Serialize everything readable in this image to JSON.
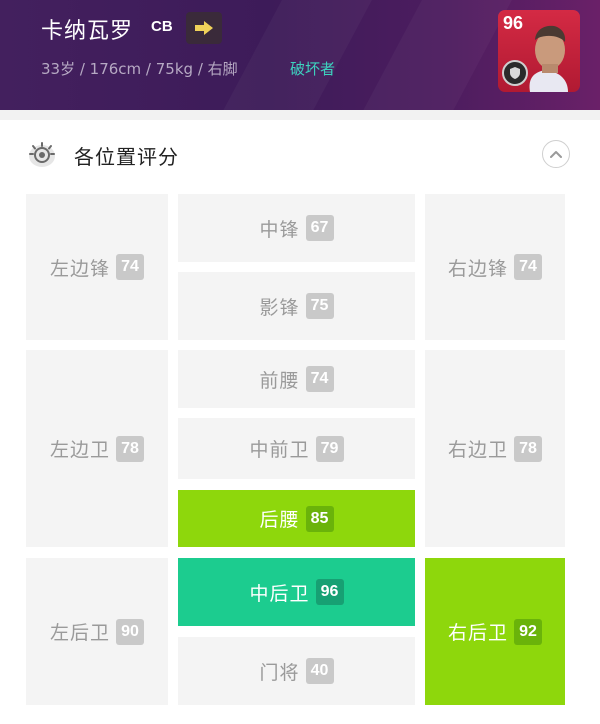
{
  "player": {
    "name": "卡纳瓦罗",
    "position": "CB",
    "stats": "33岁 / 176cm / 75kg / 右脚",
    "type": "破坏者",
    "rating": "96"
  },
  "section": {
    "title": "各位置评分"
  },
  "positions": {
    "lwf": {
      "label": "左边锋",
      "rating": "74"
    },
    "cf": {
      "label": "中锋",
      "rating": "67"
    },
    "ss": {
      "label": "影锋",
      "rating": "75"
    },
    "rwf": {
      "label": "右边锋",
      "rating": "74"
    },
    "lmf": {
      "label": "左边卫",
      "rating": "78"
    },
    "amf": {
      "label": "前腰",
      "rating": "74"
    },
    "cmf": {
      "label": "中前卫",
      "rating": "79"
    },
    "dmf": {
      "label": "后腰",
      "rating": "85"
    },
    "rmf": {
      "label": "右边卫",
      "rating": "78"
    },
    "lb": {
      "label": "左后卫",
      "rating": "90"
    },
    "cb": {
      "label": "中后卫",
      "rating": "96"
    },
    "gk": {
      "label": "门将",
      "rating": "40"
    },
    "rb": {
      "label": "右后卫",
      "rating": "92"
    }
  },
  "colors": {
    "header_bg": "#43205e",
    "player_type": "#3dd3bf",
    "card_red": "#c8243c",
    "highlight_lime": "#8ed70c",
    "highlight_teal": "#1ccc8f",
    "cell_gray": "#f4f4f4"
  },
  "icons": {
    "switch": "arrow-right-icon",
    "section": "eye-icon",
    "collapse": "chevron-up-icon",
    "card_badge": "shield-icon"
  }
}
